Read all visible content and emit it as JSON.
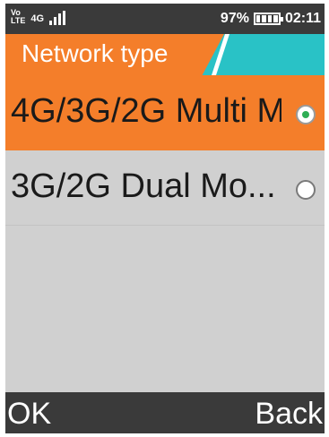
{
  "status": {
    "volte_top": "Vo",
    "volte_bottom": "LTE",
    "network": "4G",
    "battery_percent_text": "97%",
    "time": "02:11"
  },
  "header": {
    "title": "Network type",
    "accent_color": "#f47e2a",
    "secondary_color": "#29c2c6"
  },
  "list": {
    "items": [
      {
        "label": "4G/3G/2G Multi M",
        "selected": true
      },
      {
        "label": "3G/2G Dual Mo...",
        "selected": false
      }
    ]
  },
  "softkeys": {
    "left": "OK",
    "right": "Back"
  }
}
